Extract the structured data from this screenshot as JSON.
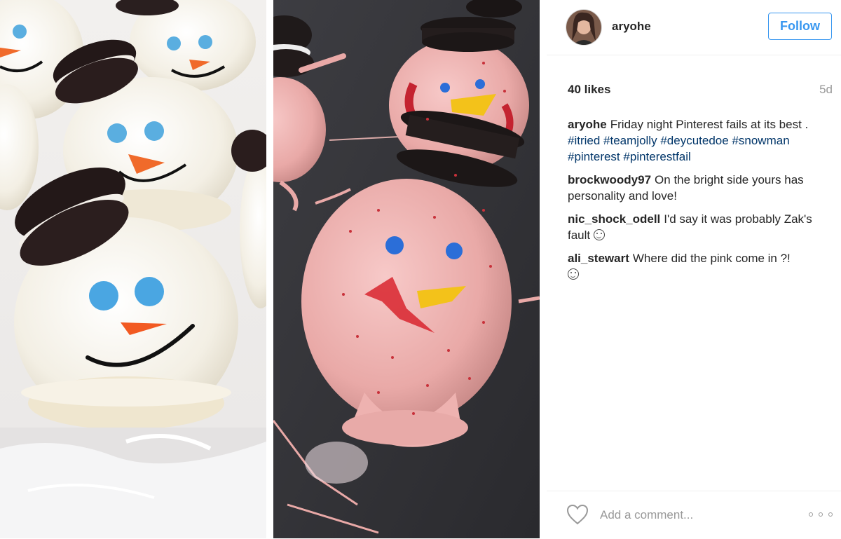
{
  "post": {
    "username": "aryohe",
    "follow_label": "Follow",
    "likes": "40 likes",
    "age": "5d"
  },
  "comments": [
    {
      "user": "aryohe",
      "text": "Friday night Pinterest fails at its best .",
      "tags": [
        "#itried",
        "#teamjolly",
        "#deycutedoe",
        "#snowman",
        "#pinterest",
        "#pinterestfail"
      ]
    },
    {
      "user": "brockwoody97",
      "text": "On the bright side yours has personality and love!"
    },
    {
      "user": "nic_shock_odell",
      "text": "I'd say it was probably Zak's fault"
    },
    {
      "user": "ali_stewart",
      "text": "Where did the pink come in ?!"
    }
  ],
  "footer": {
    "comment_placeholder": "Add a comment..."
  },
  "icons": {
    "like": "heart-icon",
    "more": "more-options-icon",
    "emoji": "smiley-emoji-icon"
  },
  "colors": {
    "accent": "#3897f0",
    "hashtag": "#003569",
    "muted": "#999999"
  }
}
